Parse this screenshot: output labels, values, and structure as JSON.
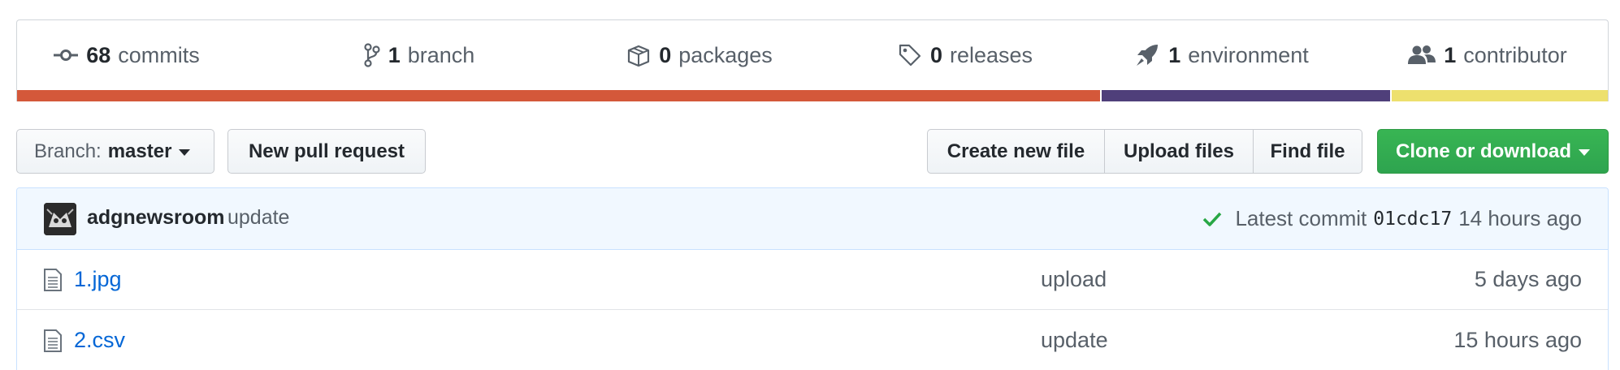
{
  "stats": [
    {
      "icon": "commit-icon",
      "count": "68",
      "label": "commits"
    },
    {
      "icon": "branch-icon",
      "count": "1",
      "label": "branch"
    },
    {
      "icon": "package-icon",
      "count": "0",
      "label": "packages"
    },
    {
      "icon": "tag-icon",
      "count": "0",
      "label": "releases"
    },
    {
      "icon": "rocket-icon",
      "count": "1",
      "label": "environment"
    },
    {
      "icon": "people-icon",
      "count": "1",
      "label": "contributor"
    }
  ],
  "language_bar": [
    {
      "share": 0.681,
      "color": "#d4583a"
    },
    {
      "share": 0.182,
      "color": "#4f3f7a"
    },
    {
      "share": 0.137,
      "color": "#ede06e"
    }
  ],
  "toolbar": {
    "branch_prefix": "Branch:",
    "branch_name": "master",
    "new_pr": "New pull request",
    "create_file": "Create new file",
    "upload_files": "Upload files",
    "find_file": "Find file",
    "clone": "Clone or download"
  },
  "latest_commit": {
    "author": "adgnewsroom",
    "message": "update",
    "label": "Latest commit",
    "sha": "01cdc17",
    "age": "14 hours ago"
  },
  "files": [
    {
      "name": "1.jpg",
      "message": "upload",
      "age": "5 days ago"
    },
    {
      "name": "2.csv",
      "message": "update",
      "age": "15 hours ago"
    }
  ],
  "colors": {
    "link": "#0366d6",
    "green_button": "#2ea44f",
    "commit_bar_bg": "#f1f8ff",
    "check": "#28a745"
  }
}
